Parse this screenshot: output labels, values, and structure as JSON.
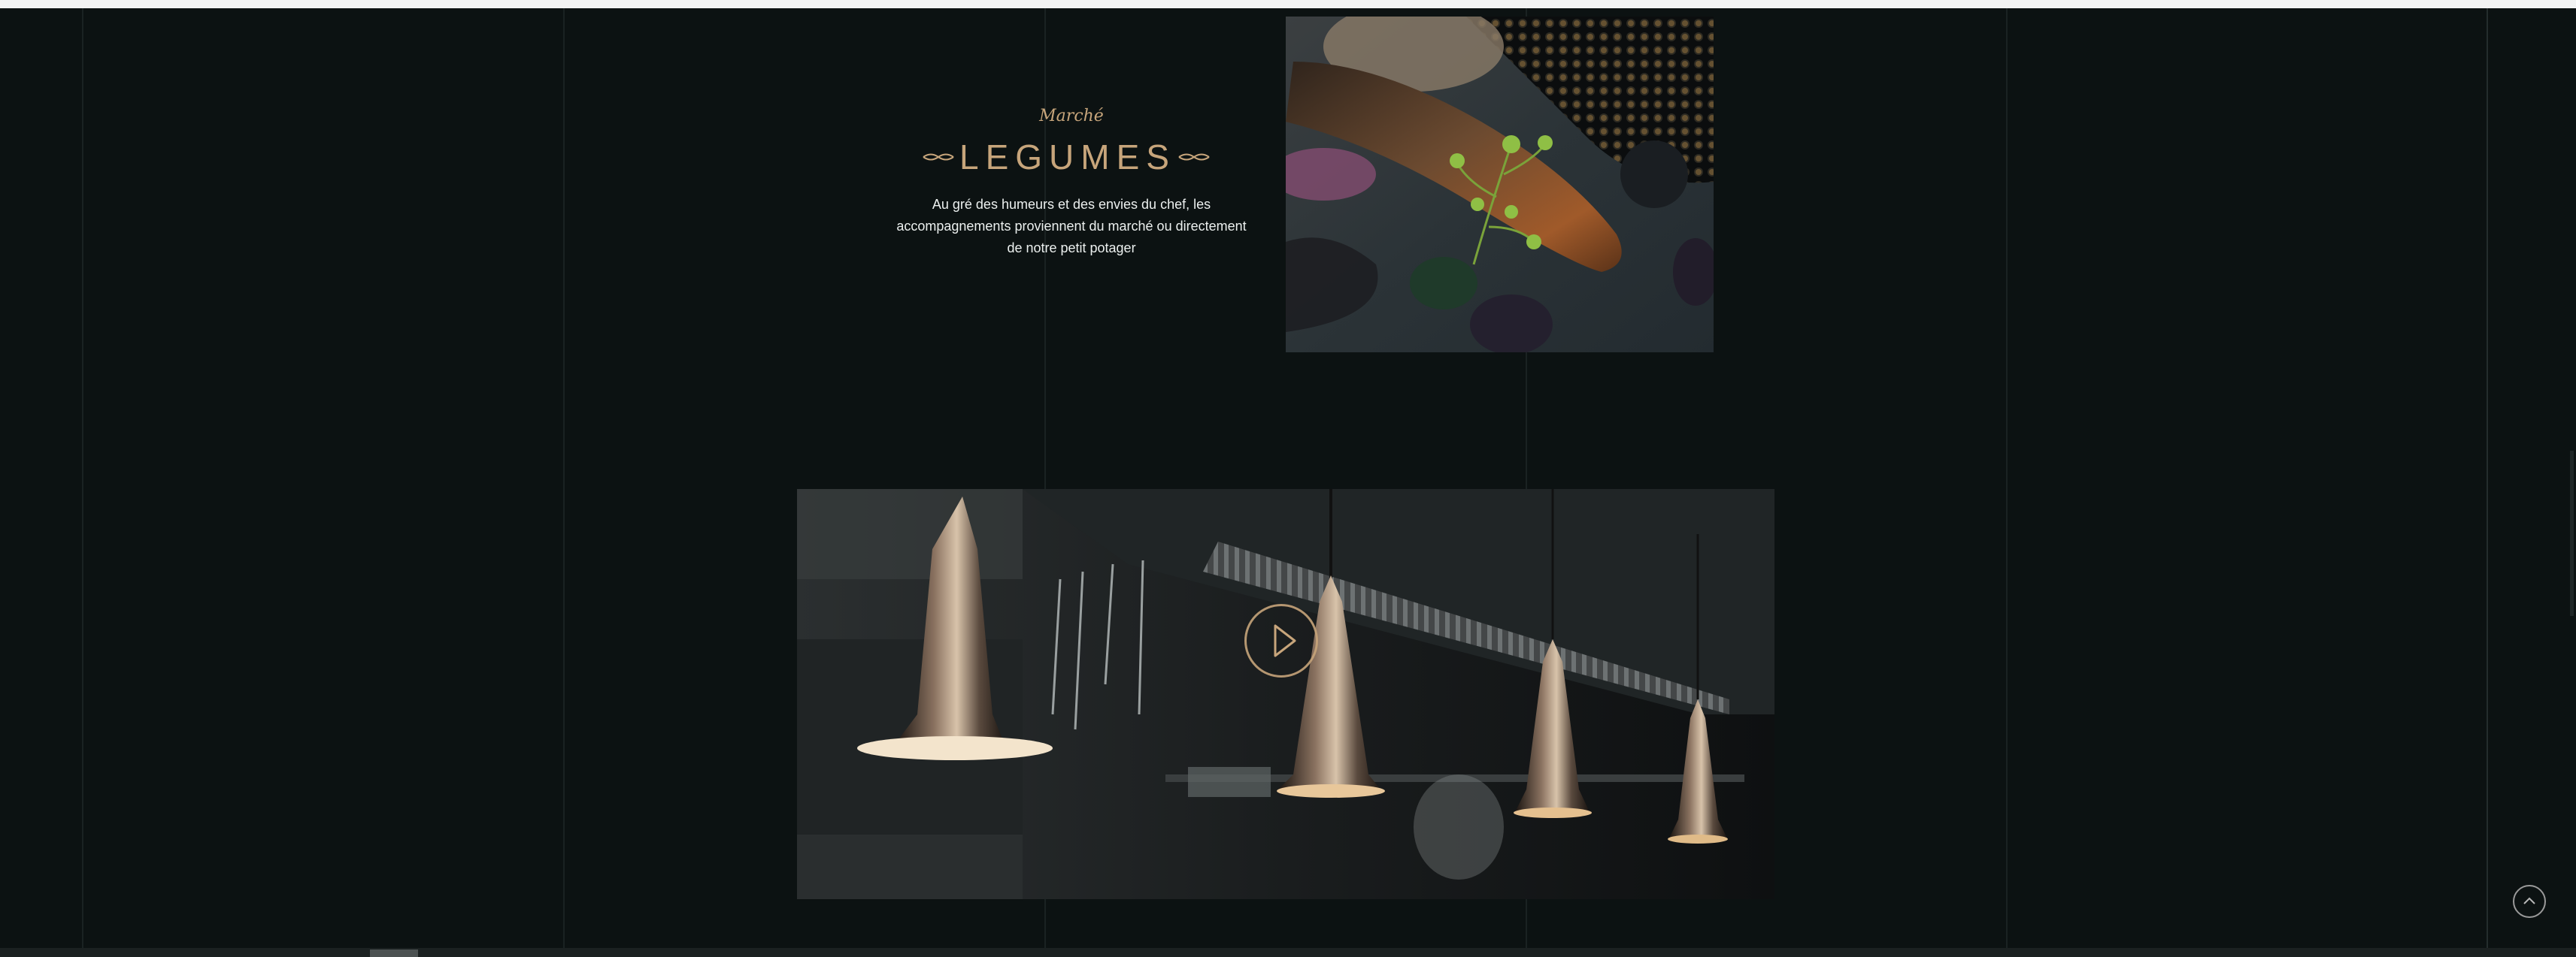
{
  "section": {
    "kicker": "Marché",
    "title": "LEGUMES",
    "description": "Au gré des humeurs et des envies du chef, les accompagnements proviennent du marché ou directement de notre petit potager"
  },
  "media": {
    "dish_image": "vegetable-dish-photo",
    "video_thumbnail": "kitchen-pendant-lamps-video",
    "play_icon": "play-icon"
  },
  "controls": {
    "back_to_top_icon": "chevron-up-icon"
  },
  "colors": {
    "background": "#0c1212",
    "accent_gold": "#c7a57b",
    "text": "#ecf0ef",
    "top_bar": "#f2f3f3"
  }
}
